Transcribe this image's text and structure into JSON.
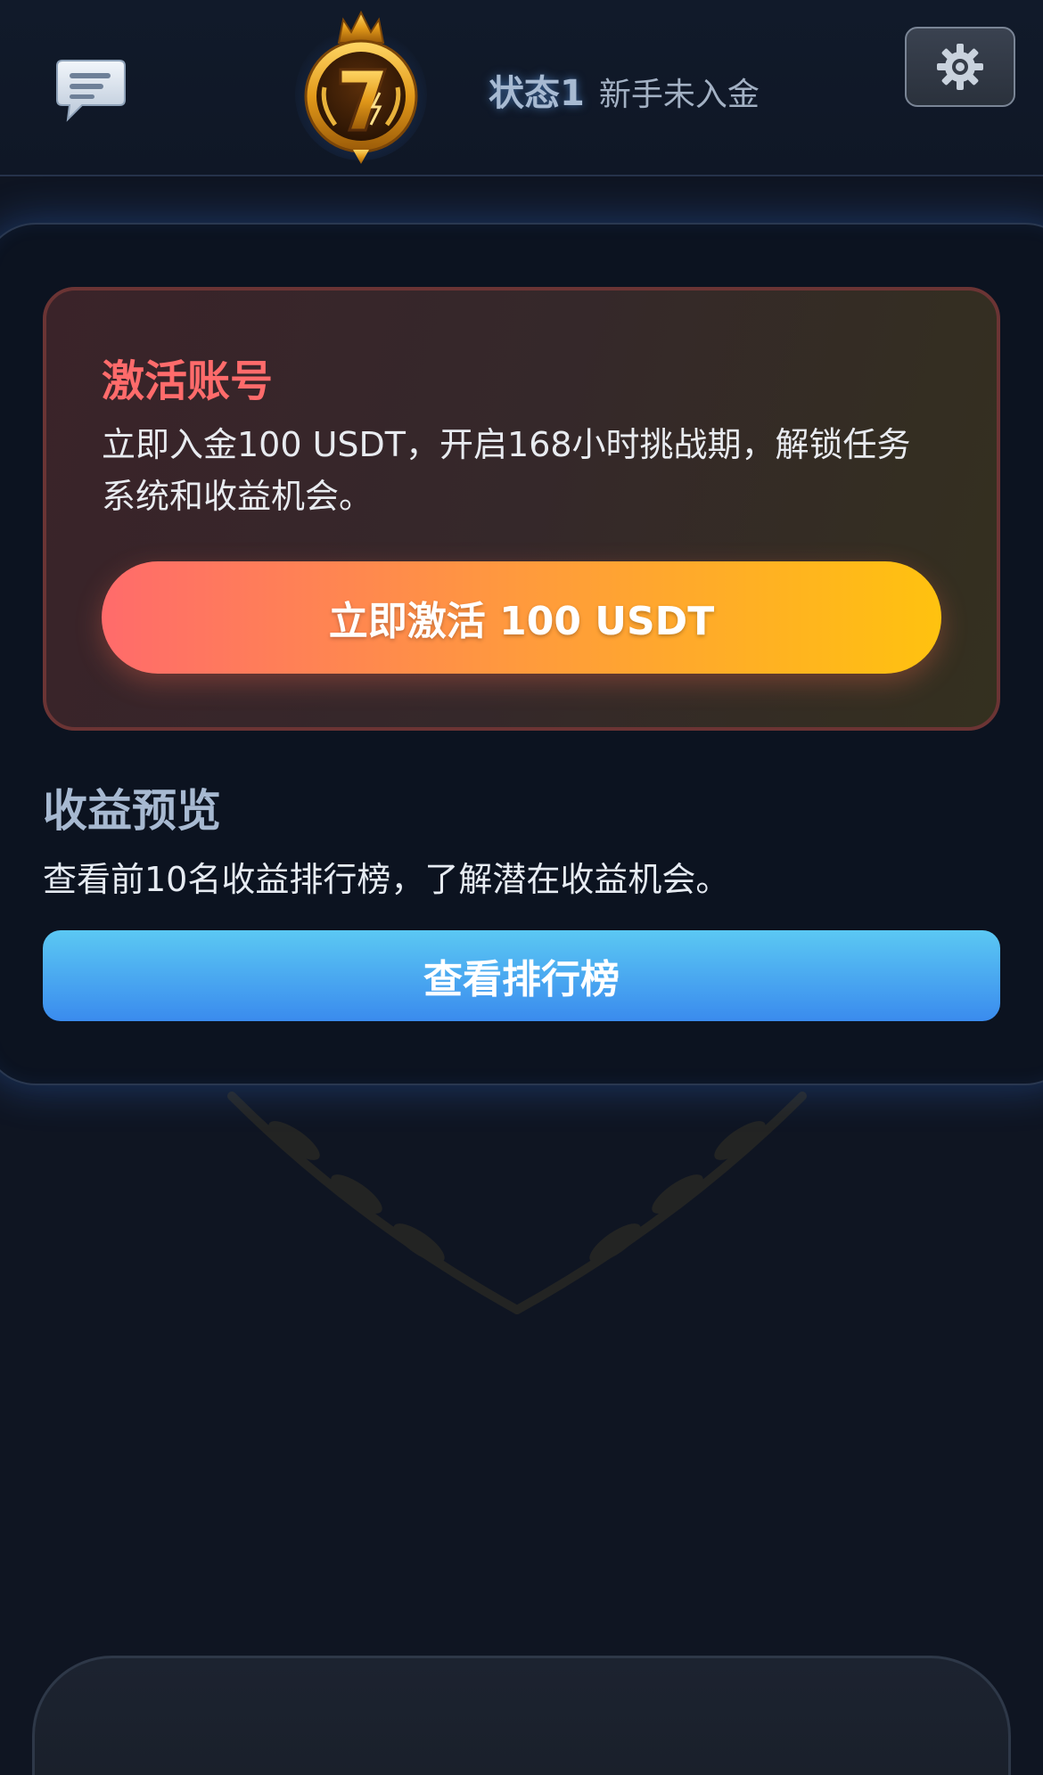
{
  "header": {
    "status_title": "状态1",
    "status_subtitle": "新手未入金",
    "chat_icon": "chat-bubble-icon",
    "logo_icon": "lucky-seven-crown-logo",
    "settings_icon": "gear-icon"
  },
  "activate": {
    "title": "激活账号",
    "description": "立即入金100 USDT，开启168小时挑战期，解锁任务系统和收益机会。",
    "button_label": "立即激活 100 USDT"
  },
  "preview": {
    "title": "收益预览",
    "description": "查看前10名收益排行榜，了解潜在收益机会。",
    "button_label": "查看排行榜"
  },
  "colors": {
    "background": "#0f1522",
    "activate_title": "#ff6b6b",
    "activate_button_start": "#ff6b6b",
    "activate_button_end": "#ffc20f",
    "ranking_button_start": "#5bc8f3",
    "ranking_button_end": "#3a8bee"
  }
}
